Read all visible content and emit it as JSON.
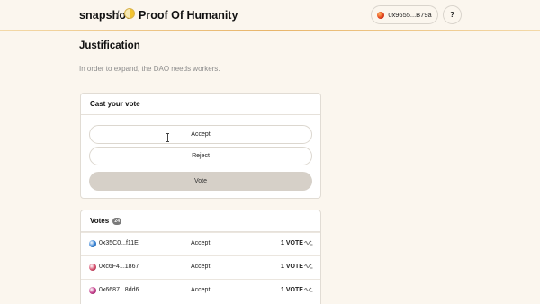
{
  "header": {
    "brand": "snapshot",
    "separator": "/",
    "space_name": "Proof Of Humanity",
    "account": "0x9655...B79a",
    "help": "?"
  },
  "justification": {
    "title": "Justification",
    "body": "In order to expand, the DAO needs workers."
  },
  "cast_vote": {
    "title": "Cast your vote",
    "choices": [
      "Accept",
      "Reject"
    ],
    "vote_label": "Vote"
  },
  "votes": {
    "title": "Votes",
    "count": "24",
    "rows": [
      {
        "address": "0x35C0...f11E",
        "choice": "Accept",
        "power": "1 VOTE",
        "avatar_color": "#2f7fd6"
      },
      {
        "address": "0xc6F4...1867",
        "choice": "Accept",
        "power": "1 VOTE",
        "avatar_color": "#d64a6a"
      },
      {
        "address": "0x6687...8dd6",
        "choice": "Accept",
        "power": "1 VOTE",
        "avatar_color": "#c43a8a"
      }
    ]
  },
  "colors": {
    "background": "#fbf6ee",
    "accent_rule": "#e8b56a",
    "vote_button": "#d6d0c8"
  }
}
